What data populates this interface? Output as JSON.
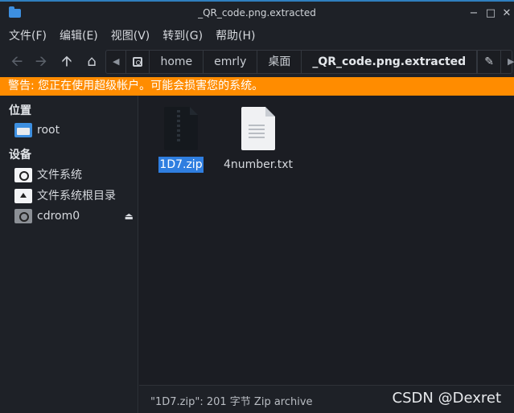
{
  "window": {
    "title": "_QR_code.png.extracted"
  },
  "menu": [
    "文件(F)",
    "编辑(E)",
    "视图(V)",
    "转到(G)",
    "帮助(H)"
  ],
  "path": [
    "home",
    "emrly",
    "桌面",
    "_QR_code.png.extracted"
  ],
  "warning": "警告: 您正在使用超级帐户。可能会损害您的系统。",
  "sidebar": {
    "places_heading": "位置",
    "places": [
      {
        "label": "root",
        "icon": "folder-icon"
      }
    ],
    "devices_heading": "设备",
    "devices": [
      {
        "label": "文件系统",
        "icon": "drive-icon"
      },
      {
        "label": "文件系统根目录",
        "icon": "root-drive-icon"
      },
      {
        "label": "cdrom0",
        "icon": "cdrom-icon"
      }
    ]
  },
  "files": [
    {
      "name": "1D7.zip",
      "icon": "zip-file-icon",
      "selected": true
    },
    {
      "name": "4number.txt",
      "icon": "text-file-icon",
      "selected": false
    }
  ],
  "status": "\"1D7.zip\": 201 字节 Zip archive",
  "watermark": "CSDN @Dexret",
  "colors": {
    "warning": "#ff8c00",
    "selection": "#2f7ee0",
    "accent": "#3d8fe0"
  }
}
